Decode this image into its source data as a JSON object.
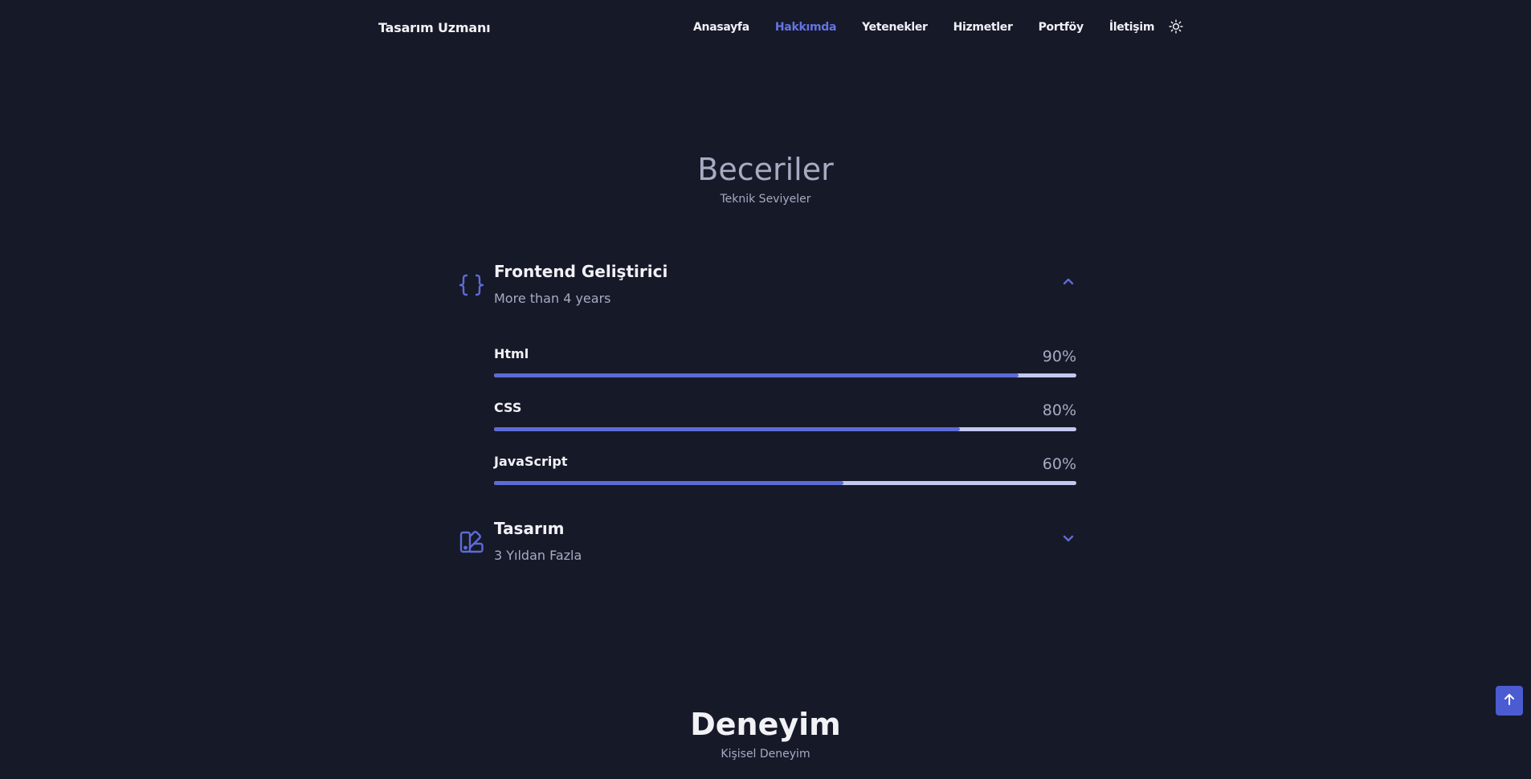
{
  "nav": {
    "logo": "Tasarım Uzmanı",
    "items": [
      {
        "label": "Anasayfa"
      },
      {
        "label": "Hakkımda"
      },
      {
        "label": "Yetenekler"
      },
      {
        "label": "Hizmetler"
      },
      {
        "label": "Portföy"
      },
      {
        "label": "İletişim"
      }
    ],
    "active_index": 1,
    "theme_icon": "sun-icon"
  },
  "skills": {
    "title": "Beceriler",
    "subtitle": "Teknik Seviyeler",
    "groups": [
      {
        "title": "Frontend Geliştirici",
        "subtitle": "More than 4 years",
        "icon": "code-braces-icon",
        "expanded": true,
        "items": [
          {
            "name": "Html",
            "percent_label": "90%",
            "level": 0.9
          },
          {
            "name": "CSS",
            "percent_label": "80%",
            "level": 0.8
          },
          {
            "name": "JavaScript",
            "percent_label": "60%",
            "level": 0.6
          }
        ]
      },
      {
        "title": "Tasarım",
        "subtitle": "3 Yıldan Fazla",
        "icon": "swatchbook-icon",
        "expanded": false
      }
    ]
  },
  "experience": {
    "title": "Deneyim",
    "subtitle": "Kişisel Deneyim"
  },
  "scroll_top_icon": "arrow-up-icon",
  "colors": {
    "background": "#161928",
    "accent": "#5d6bd7",
    "text": "#f1f1f6",
    "muted": "#a7abc2",
    "track": "#c4c8ef"
  }
}
